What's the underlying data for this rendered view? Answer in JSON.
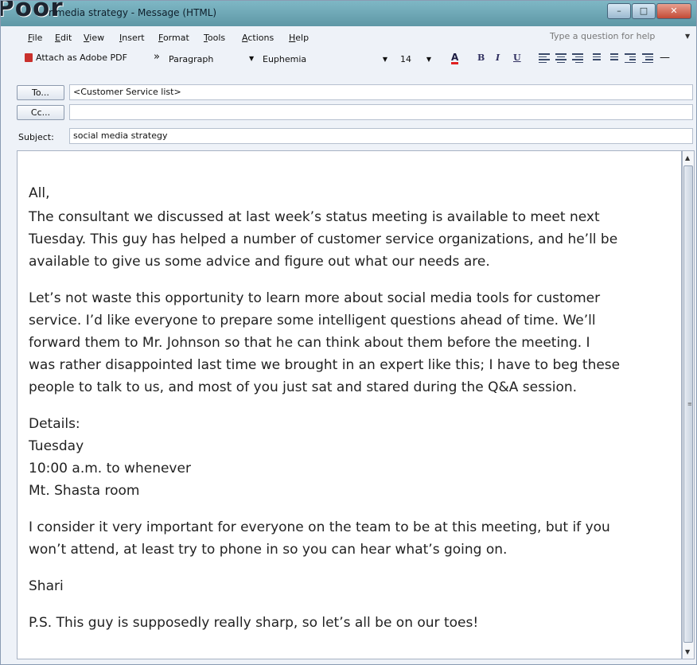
{
  "window": {
    "badge_text": "Poor",
    "title": "social media strategy - Message (HTML)",
    "title_visible": "r media strategy - Message (HTML)",
    "controls": [
      "minimize",
      "maximize",
      "close"
    ]
  },
  "menu": {
    "items": [
      "File",
      "Edit",
      "View",
      "Insert",
      "Format",
      "Tools",
      "Actions",
      "Help"
    ],
    "help_placeholder": "Type a question for help"
  },
  "toolbar": {
    "attach_pdf": "Attach as Adobe PDF",
    "overflow": "»",
    "style": "Paragraph",
    "font": "Euphemia",
    "size": "14",
    "font_color_label": "A",
    "bold": "B",
    "italic": "I",
    "underline": "U"
  },
  "header": {
    "to_label": "To...",
    "to_value": "<Customer Service list>",
    "cc_label": "Cc...",
    "cc_value": "",
    "subject_label": "Subject:",
    "subject_value": "social media strategy"
  },
  "body": {
    "greeting": "All,",
    "p1": [
      "The consultant we discussed at last week’s status meeting is available to meet next",
      "Tuesday. This guy has helped a number of customer service organizations, and he’ll be",
      "available to give us some advice and figure out what our needs are."
    ],
    "p2": [
      "Let’s not waste this opportunity to learn more about social media tools for customer",
      "service. I’d like everyone to prepare some intelligent questions ahead of time. We’ll",
      "forward them to Mr. Johnson so that he can think about them before the meeting. I",
      "was rather disappointed last time we brought in an expert like this; I have to beg these",
      "people to talk to us, and most of you just sat and stared during the Q&A session."
    ],
    "details": [
      "Details:",
      "Tuesday",
      "10:00 a.m. to whenever",
      "Mt. Shasta room"
    ],
    "p3": [
      "I consider it very important for everyone on the team to be at this meeting, but if you",
      "won’t attend, at least try to phone in so you can hear what’s going on."
    ],
    "signature": "Shari",
    "ps": "P.S. This guy is supposedly really sharp, so let’s all be on our toes!"
  }
}
